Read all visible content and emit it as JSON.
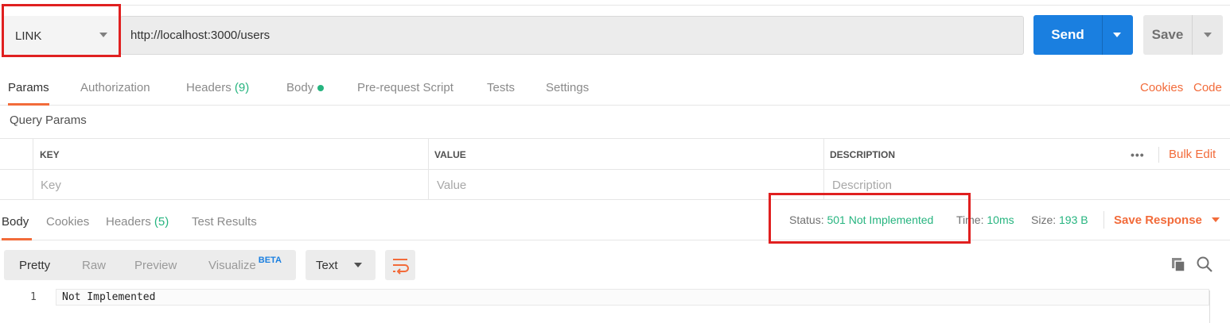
{
  "request": {
    "method": "LINK",
    "url": "http://localhost:3000/users",
    "send_label": "Send",
    "save_label": "Save"
  },
  "request_tabs": [
    {
      "label": "Params",
      "active": true
    },
    {
      "label": "Authorization"
    },
    {
      "label": "Headers",
      "count": "(9)"
    },
    {
      "label": "Body",
      "indicator": "green-dot"
    },
    {
      "label": "Pre-request Script"
    },
    {
      "label": "Tests"
    },
    {
      "label": "Settings"
    }
  ],
  "request_links": {
    "cookies": "Cookies",
    "code": "Code"
  },
  "query_params": {
    "title": "Query Params",
    "headers": {
      "key": "KEY",
      "value": "VALUE",
      "description": "DESCRIPTION"
    },
    "placeholders": {
      "key": "Key",
      "value": "Value",
      "description": "Description"
    },
    "more": "•••",
    "bulk_edit": "Bulk Edit"
  },
  "response_tabs": [
    {
      "label": "Body",
      "active": true
    },
    {
      "label": "Cookies"
    },
    {
      "label": "Headers",
      "count": "(5)"
    },
    {
      "label": "Test Results"
    }
  ],
  "response_status": {
    "status_label": "Status:",
    "status_value": "501 Not Implemented",
    "time_label": "Time:",
    "time_value": "10ms",
    "size_label": "Size:",
    "size_value": "193 B",
    "save_response": "Save Response"
  },
  "response_toolbar": {
    "formats": [
      "Pretty",
      "Raw",
      "Preview",
      "Visualize"
    ],
    "beta": "BETA",
    "text_type": "Text"
  },
  "response_body": {
    "lines": [
      {
        "num": "1",
        "text": "Not Implemented"
      }
    ]
  },
  "colors": {
    "accent": "#f26b3a",
    "send_blue": "#1a7fe0",
    "success_green": "#26b47f",
    "highlight_red": "#e02020"
  }
}
